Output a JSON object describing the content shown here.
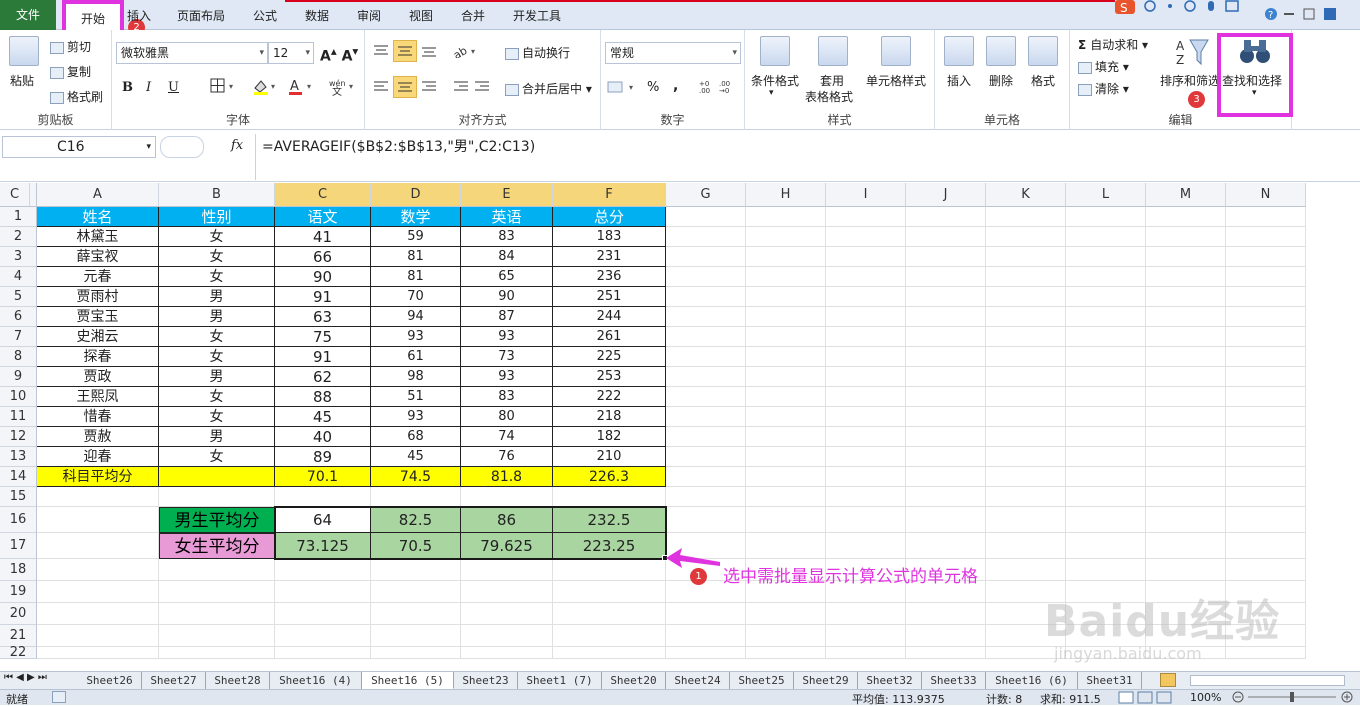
{
  "menu": {
    "tabs": [
      "文件",
      "开始",
      "插入",
      "页面布局",
      "公式",
      "数据",
      "审阅",
      "视图",
      "合并",
      "开发工具"
    ]
  },
  "ribbon": {
    "clipboard": {
      "paste": "粘贴",
      "cut": "剪切",
      "copy": "复制",
      "format_painter": "格式刷",
      "label": "剪贴板"
    },
    "font": {
      "name": "微软雅黑",
      "size": "12",
      "bold": "B",
      "italic": "I",
      "underline": "U",
      "label": "字体"
    },
    "align": {
      "wrap": "自动换行",
      "merge": "合并后居中",
      "label": "对齐方式"
    },
    "number": {
      "format": "常规",
      "percent": "%",
      "comma": ",",
      "label": "数字"
    },
    "styles": {
      "cond": "条件格式",
      "table1": "套用",
      "table2": "表格格式",
      "cell": "单元格样式",
      "label": "样式"
    },
    "cells": {
      "insert": "插入",
      "delete": "删除",
      "format": "格式",
      "label": "单元格"
    },
    "edit": {
      "autosum": "自动求和",
      "fill": "填充",
      "clear": "清除",
      "sort": "排序和筛选",
      "find": "查找和选择",
      "label": "编辑"
    }
  },
  "badges": [
    "1",
    "2",
    "3"
  ],
  "formula_bar": {
    "name_box": "C16",
    "fx": "fx",
    "formula": "=AVERAGEIF($B$2:$B$13,\"男\",C2:C13)"
  },
  "columns": [
    "A",
    "B",
    "C",
    "D",
    "E",
    "F",
    "G",
    "H",
    "I",
    "J",
    "K",
    "L",
    "M",
    "N",
    "C"
  ],
  "rows": [
    "1",
    "2",
    "3",
    "4",
    "5",
    "6",
    "7",
    "8",
    "9",
    "10",
    "11",
    "12",
    "13",
    "14",
    "15",
    "16",
    "17",
    "18",
    "19",
    "20",
    "21",
    "22"
  ],
  "table": {
    "headers": [
      "姓名",
      "性别",
      "语文",
      "数学",
      "英语",
      "总分"
    ],
    "rows": [
      [
        "林黛玉",
        "女",
        "41",
        "59",
        "83",
        "183"
      ],
      [
        "薛宝衩",
        "女",
        "66",
        "81",
        "84",
        "231"
      ],
      [
        "元春",
        "女",
        "90",
        "81",
        "65",
        "236"
      ],
      [
        "贾雨村",
        "男",
        "91",
        "70",
        "90",
        "251"
      ],
      [
        "贾宝玉",
        "男",
        "63",
        "94",
        "87",
        "244"
      ],
      [
        "史湘云",
        "女",
        "75",
        "93",
        "93",
        "261"
      ],
      [
        "探春",
        "女",
        "91",
        "61",
        "73",
        "225"
      ],
      [
        "贾政",
        "男",
        "62",
        "98",
        "93",
        "253"
      ],
      [
        "王熙凤",
        "女",
        "88",
        "51",
        "83",
        "222"
      ],
      [
        "惜春",
        "女",
        "45",
        "93",
        "80",
        "218"
      ],
      [
        "贾赦",
        "男",
        "40",
        "68",
        "74",
        "182"
      ],
      [
        "迎春",
        "女",
        "89",
        "45",
        "76",
        "210"
      ]
    ],
    "avg_row": [
      "科目平均分",
      "",
      "70.1",
      "74.5",
      "81.8",
      "226.3"
    ]
  },
  "summary": {
    "male": {
      "label": "男生平均分",
      "values": [
        "64",
        "82.5",
        "86",
        "232.5"
      ]
    },
    "female": {
      "label": "女生平均分",
      "values": [
        "73.125",
        "70.5",
        "79.625",
        "223.25"
      ]
    }
  },
  "annotation": "选中需批量显示计算公式的单元格",
  "watermark": {
    "brand": "Baidu经验",
    "url": "jingyan.baidu.com"
  },
  "sheets": [
    "Sheet26",
    "Sheet27",
    "Sheet28",
    "Sheet16 (4)",
    "Sheet16 (5)",
    "Sheet23",
    "Sheet1 (7)",
    "Sheet20",
    "Sheet24",
    "Sheet25",
    "Sheet29",
    "Sheet32",
    "Sheet33",
    "Sheet16 (6)",
    "Sheet31"
  ],
  "active_sheet": "Sheet16 (5)",
  "status": {
    "ready": "就绪",
    "average": "平均值: 113.9375",
    "count": "计数: 8",
    "sum": "求和: 911.5",
    "zoom": "100%"
  },
  "colors": {
    "header_fill": "#00b0f0",
    "yellow": "#ffff00",
    "green": "#a9d5a1",
    "male_label": "#00b050",
    "female_label": "#e89ad6",
    "highlight": "#e033e0"
  }
}
